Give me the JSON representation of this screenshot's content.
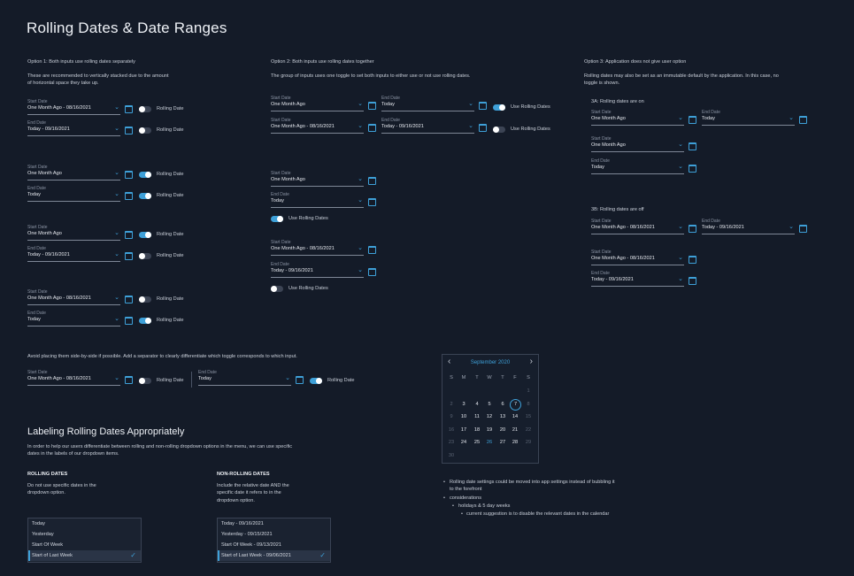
{
  "title": "Rolling Dates & Date Ranges",
  "col1": {
    "heading": "Option 1: Both inputs use rolling dates separately",
    "desc1": "These are recommended to vertically stacked due to the amount",
    "desc2": "of horizontal space they take up."
  },
  "col2": {
    "heading": "Option 2: Both inputs use rolling dates together",
    "desc": "The group of inputs uses one toggle to set both inputs to either use or not use rolling dates."
  },
  "col3": {
    "heading": "Option 3: Application does not give user option",
    "desc1": "Rolling dates may also be set as an immutable default by the application. In this case, no",
    "desc2": "toggle is shown.",
    "sub_a": "3A: Rolling dates are on",
    "sub_b": "3B: Rolling dates are off"
  },
  "labels": {
    "start": "Start Date",
    "end": "End Date",
    "rolling": "Rolling Date",
    "use_rolling": "Use Rolling Dates"
  },
  "values": {
    "one_month_ago": "One Month Ago",
    "one_month_ago_date": "One Month Ago - 08/16/2021",
    "today": "Today",
    "today_date": "Today - 09/16/2021"
  },
  "side_by_side_note": "Avoid placing them side-by-side if possible. Add a separator to clearly differentiate which toggle corresponds to which input.",
  "labeling": {
    "heading": "Labeling Rolling Dates Appropriately",
    "desc1": "In order to help our users differentiate between rolling and non-rolling dropdown options in the menu, we can use specific",
    "desc2": "dates in the labels of our dropdown items.",
    "rolling_title": "ROLLING DATES",
    "rolling_desc1": "Do not use specific dates in the",
    "rolling_desc2": "dropdown option.",
    "nonrolling_title": "NON-ROLLING DATES",
    "nonrolling_desc1": "Include the relative date AND the",
    "nonrolling_desc2": "specific date it refers to in the",
    "nonrolling_desc3": "dropdown option."
  },
  "menu_rolling": [
    "Today",
    "Yesterday",
    "Start Of Week",
    "Start of Last Week"
  ],
  "menu_nonrolling": [
    "Today - 09/16/2021",
    "Yesterday - 09/15/2021",
    "Start Of Week - 09/13/2021",
    "Start of Last Week - 09/06/2021"
  ],
  "calendar": {
    "month": "September 2020",
    "dows": [
      "S",
      "M",
      "T",
      "W",
      "T",
      "F",
      "S"
    ],
    "selected": "7",
    "accent_day": "26"
  },
  "notes": {
    "b1": "Rolling date settings could be moved into app settings instead of bubbling it",
    "b1b": "to the forefront",
    "b2": "considerations",
    "b3": "holidays & 5 day weeks",
    "b4": "current suggestion is to disable the relevant dates in the calendar"
  },
  "colors": {
    "accent": "#3ea0d8",
    "background": "#141b28"
  }
}
